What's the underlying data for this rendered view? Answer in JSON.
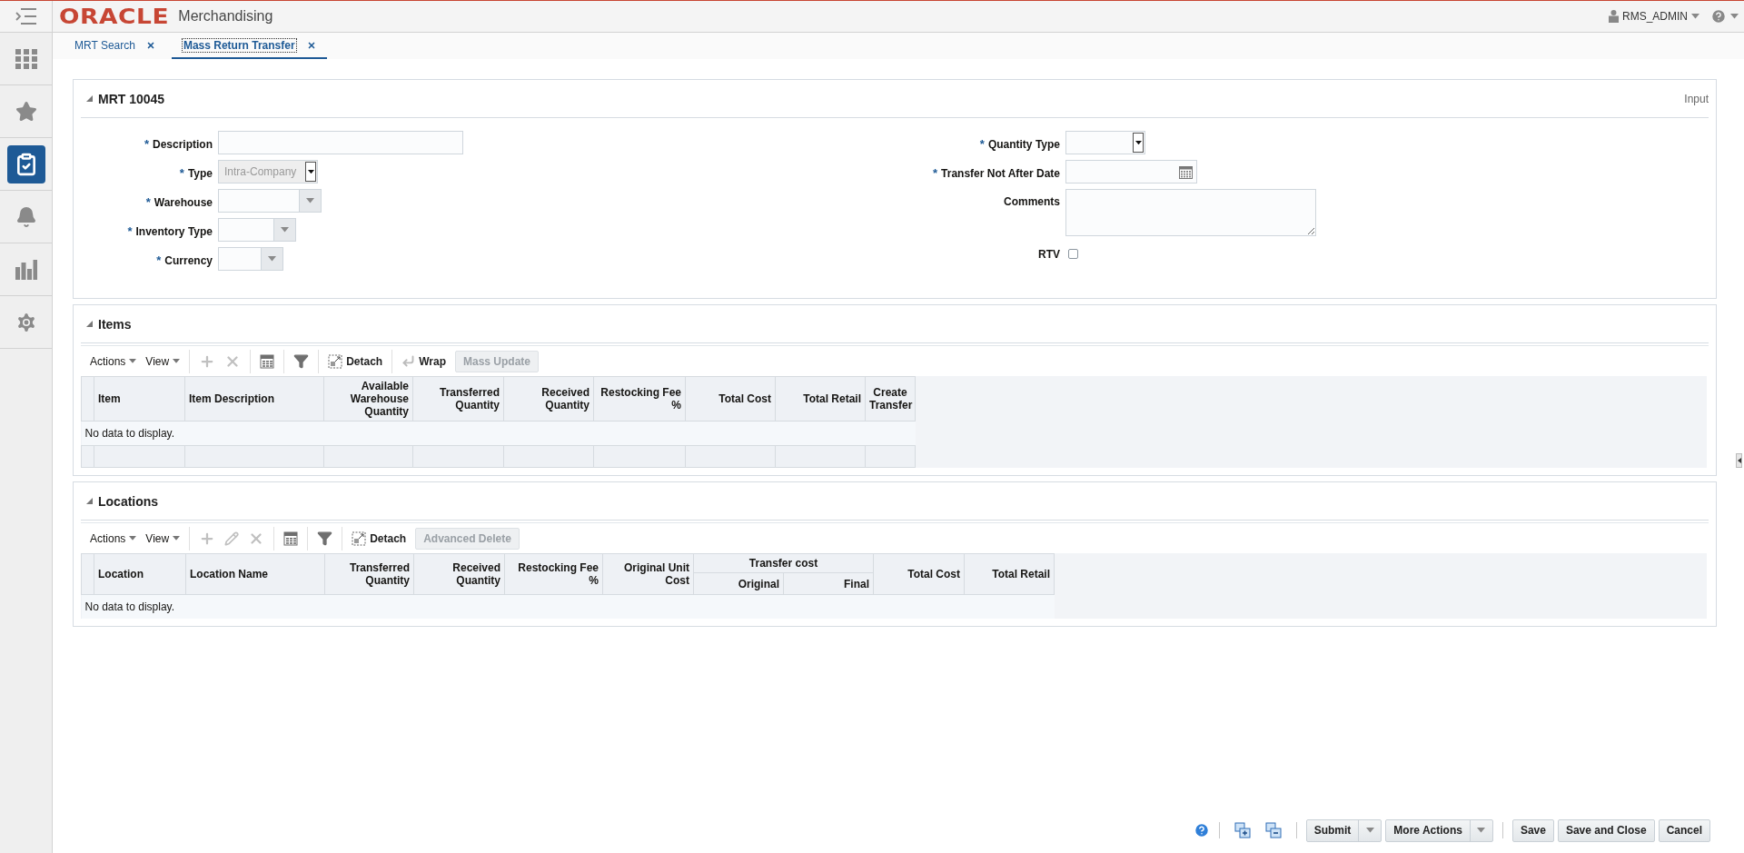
{
  "header": {
    "logo": "ORACLE",
    "app_name": "Merchandising",
    "user": "RMS_ADMIN"
  },
  "sidebar": [
    {
      "kind": "apps",
      "selected": false
    },
    {
      "kind": "favorites",
      "selected": false
    },
    {
      "kind": "tasks",
      "selected": true
    },
    {
      "kind": "notifications",
      "selected": false
    },
    {
      "kind": "reports",
      "selected": false
    },
    {
      "kind": "settings",
      "selected": false
    }
  ],
  "tabs": [
    {
      "label": "MRT Search",
      "selected": false
    },
    {
      "label": "Mass Return Transfer",
      "selected": true
    }
  ],
  "required_mark": "*",
  "header_panel": {
    "title": "MRT 10045",
    "mode": "Input",
    "expanded": true,
    "left_fields": [
      {
        "label": "Description",
        "required": true,
        "kind": "text",
        "disabled": false
      },
      {
        "label": "Type",
        "required": true,
        "kind": "choice",
        "value": "Intra-Company",
        "disabled": true
      },
      {
        "label": "Warehouse",
        "required": true,
        "kind": "combo",
        "disabled": false
      },
      {
        "label": "Inventory Type",
        "required": true,
        "kind": "combo",
        "disabled": false
      },
      {
        "label": "Currency",
        "required": true,
        "kind": "combo",
        "disabled": false
      }
    ],
    "right_fields": [
      {
        "label": "Quantity Type",
        "required": true,
        "kind": "choice",
        "disabled": false
      },
      {
        "label": "Transfer Not After Date",
        "required": true,
        "kind": "date",
        "disabled": false
      },
      {
        "label": "Comments",
        "required": false,
        "kind": "textarea",
        "disabled": false
      },
      {
        "label": "RTV",
        "required": false,
        "kind": "checkbox",
        "checked": false,
        "disabled": false
      }
    ]
  },
  "items": {
    "title": "Items",
    "expanded": true,
    "toolbar": [
      {
        "tools": [
          {
            "kind": "menu",
            "label": "Actions",
            "disabled": false
          },
          {
            "kind": "menu",
            "label": "View",
            "disabled": false
          }
        ]
      },
      {
        "tools": [
          {
            "kind": "add",
            "disabled": true
          },
          {
            "kind": "delete",
            "disabled": true
          }
        ]
      },
      {
        "tools": [
          {
            "kind": "export",
            "disabled": false
          }
        ]
      },
      {
        "tools": [
          {
            "kind": "filter",
            "disabled": false
          }
        ]
      },
      {
        "tools": [
          {
            "kind": "detach",
            "label": "Detach",
            "disabled": false
          }
        ]
      },
      {
        "tools": [
          {
            "kind": "wrap",
            "label": "Wrap",
            "disabled": false
          },
          {
            "kind": "button",
            "label": "Mass Update",
            "disabled": true
          }
        ]
      }
    ],
    "columns": [
      {
        "label": "Item",
        "kind": "text"
      },
      {
        "label": "Item Description",
        "kind": "text"
      },
      {
        "label": "Available Warehouse Quantity",
        "kind": "number"
      },
      {
        "label": "Transferred Quantity",
        "kind": "number"
      },
      {
        "label": "Received Quantity",
        "kind": "number"
      },
      {
        "label": "Restocking Fee %",
        "kind": "number"
      },
      {
        "label": "Total Cost",
        "kind": "number"
      },
      {
        "label": "Total Retail",
        "kind": "number"
      },
      {
        "label": "Create Transfer",
        "kind": "flag"
      }
    ],
    "empty_text": "No data to display.",
    "totals_row": true
  },
  "locations": {
    "title": "Locations",
    "expanded": true,
    "toolbar": [
      {
        "tools": [
          {
            "kind": "menu",
            "label": "Actions",
            "disabled": false
          },
          {
            "kind": "menu",
            "label": "View",
            "disabled": false
          }
        ]
      },
      {
        "tools": [
          {
            "kind": "add",
            "disabled": true
          },
          {
            "kind": "edit",
            "disabled": true
          },
          {
            "kind": "delete",
            "disabled": true
          }
        ]
      },
      {
        "tools": [
          {
            "kind": "export",
            "disabled": false
          }
        ]
      },
      {
        "tools": [
          {
            "kind": "filter",
            "disabled": false
          }
        ]
      },
      {
        "tools": [
          {
            "kind": "detach",
            "label": "Detach",
            "disabled": false
          },
          {
            "kind": "button",
            "label": "Advanced Delete",
            "disabled": true
          }
        ]
      }
    ],
    "columns": [
      {
        "label": "Location",
        "kind": "text"
      },
      {
        "label": "Location Name",
        "kind": "text"
      },
      {
        "label": "Transferred Quantity",
        "kind": "number"
      },
      {
        "label": "Received Quantity",
        "kind": "number"
      },
      {
        "label": "Restocking Fee %",
        "kind": "number"
      },
      {
        "label": "Original Unit Cost",
        "kind": "number"
      },
      {
        "label": "Transfer cost",
        "kind": "group",
        "children": [
          {
            "label": "Original",
            "kind": "number"
          },
          {
            "label": "Final",
            "kind": "number"
          }
        ]
      },
      {
        "label": "Total Cost",
        "kind": "number"
      },
      {
        "label": "Total Retail",
        "kind": "number"
      }
    ],
    "empty_text": "No data to display.",
    "totals_row": false
  },
  "footer": [
    {
      "actions": [
        {
          "kind": "help"
        }
      ]
    },
    {
      "actions": [
        {
          "kind": "expand"
        },
        {
          "kind": "collapse"
        }
      ]
    },
    {
      "actions": [
        {
          "kind": "split",
          "label": "Submit"
        },
        {
          "kind": "split",
          "label": "More Actions"
        }
      ]
    },
    {
      "actions": [
        {
          "kind": "button",
          "label": "Save"
        },
        {
          "kind": "button",
          "label": "Save and Close"
        },
        {
          "kind": "button",
          "label": "Cancel"
        }
      ]
    }
  ]
}
